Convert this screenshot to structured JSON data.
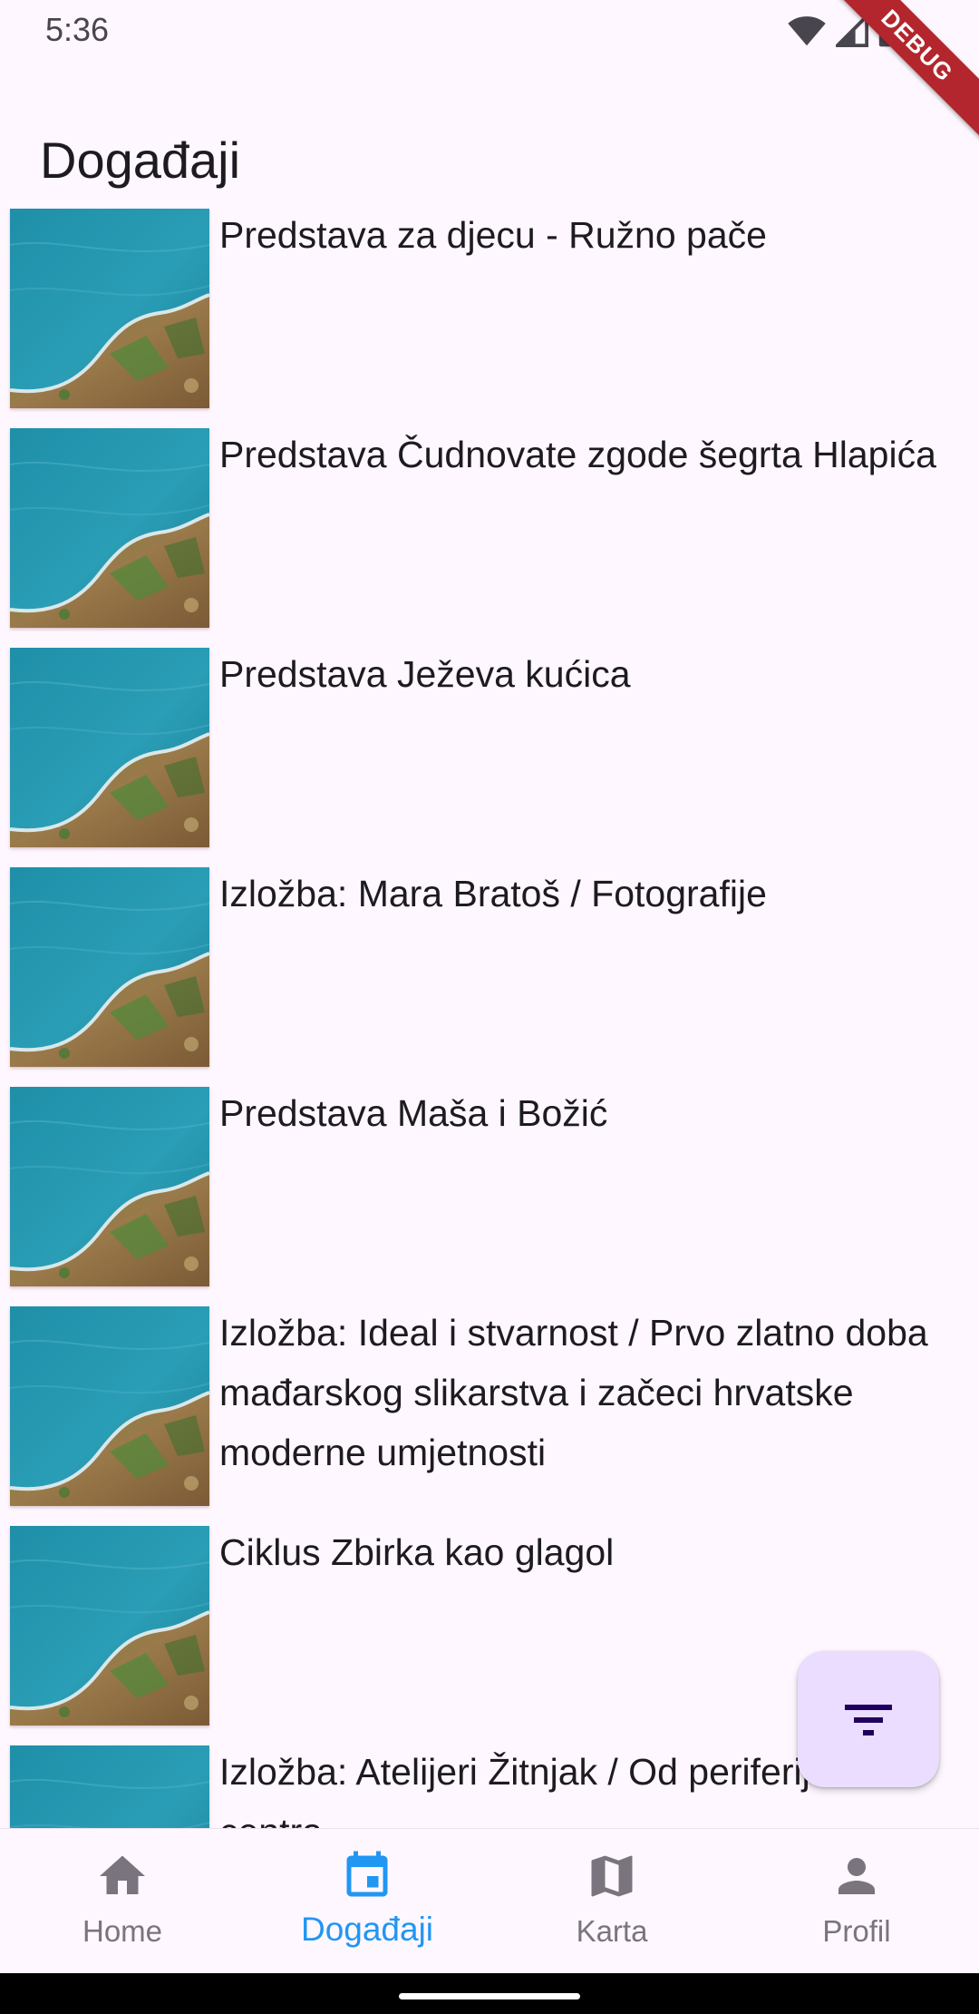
{
  "status_bar": {
    "time": "5:36"
  },
  "debug_banner": "DEBUG",
  "app_bar": {
    "title": "Događaji"
  },
  "events": [
    {
      "title": "Predstava za djecu - Ružno pače"
    },
    {
      "title": "Predstava Čudnovate zgode šegrta Hlapića"
    },
    {
      "title": "Predstava Ježeva kućica"
    },
    {
      "title": "Izložba: Mara Bratoš / Fotografije"
    },
    {
      "title": "Predstava Maša i Božić"
    },
    {
      "title": "Izložba: Ideal i stvarnost / Prvo zlatno doba mađarskog slikarstva i začeci hrvatske moderne umjetnosti"
    },
    {
      "title": "Ciklus Zbirka kao glagol"
    },
    {
      "title": "Izložba: Atelijeri Žitnjak / Od periferije do centra"
    }
  ],
  "fab": {
    "icon": "filter-icon"
  },
  "bottom_nav": {
    "items": [
      {
        "label": "Home",
        "icon": "home-icon",
        "active": false
      },
      {
        "label": "Događaji",
        "icon": "calendar-icon",
        "active": true
      },
      {
        "label": "Karta",
        "icon": "map-icon",
        "active": false
      },
      {
        "label": "Profil",
        "icon": "person-icon",
        "active": false
      }
    ]
  },
  "colors": {
    "background": "#fef7ff",
    "active_nav": "#2196f3",
    "inactive_nav": "#79747e",
    "fab_bg": "#eaddff",
    "debug_ribbon": "#b3262d"
  }
}
